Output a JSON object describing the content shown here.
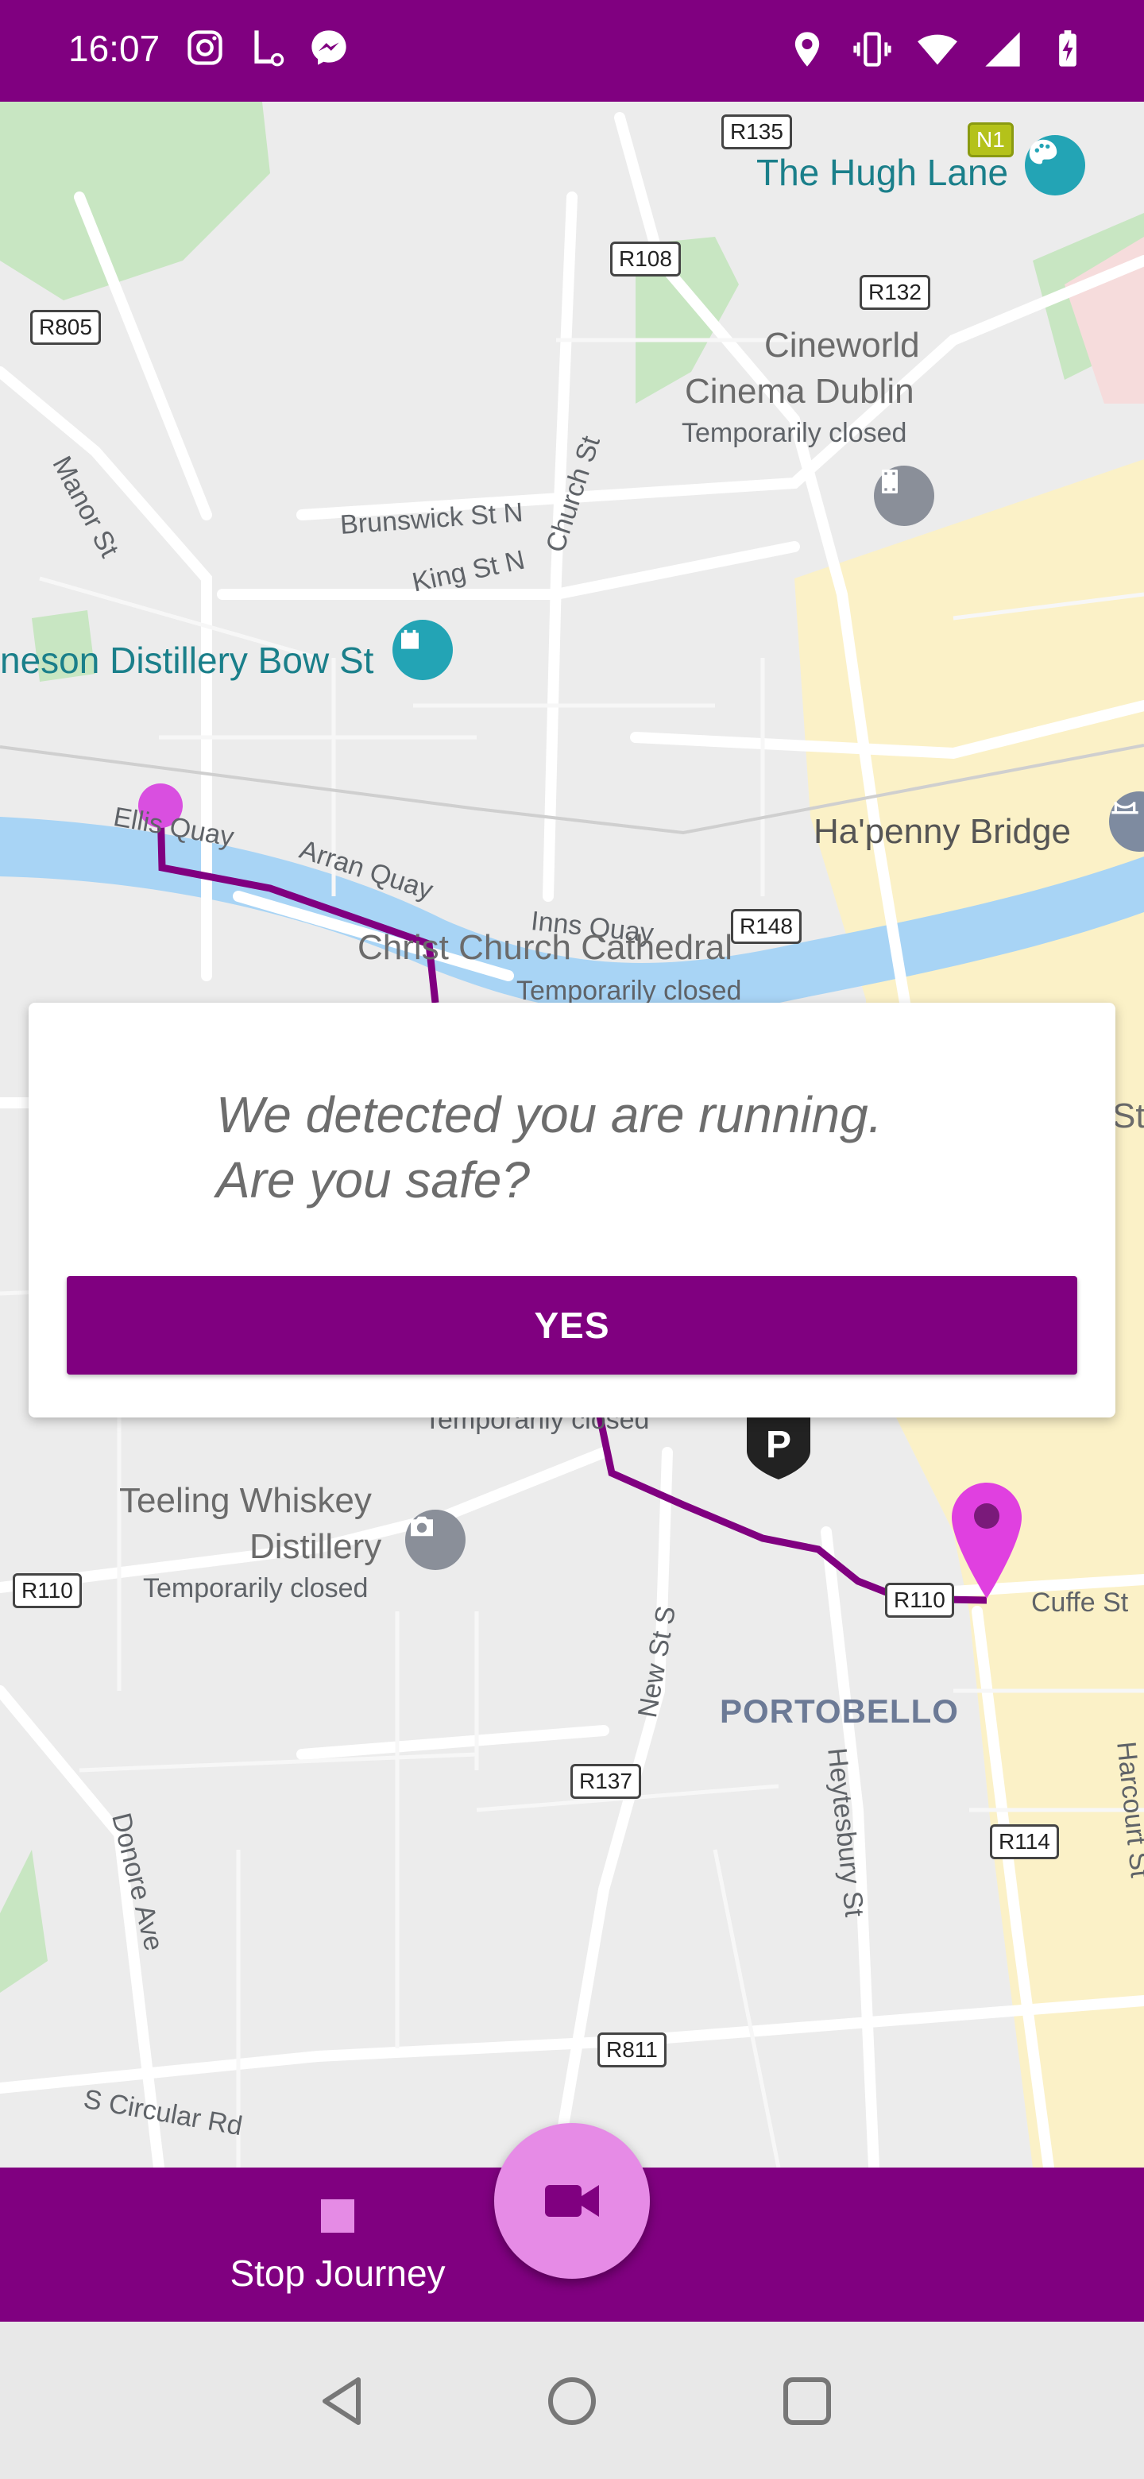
{
  "status_bar": {
    "time": "16:07",
    "left_icons": [
      "instagram-icon",
      "location-badge-icon",
      "messenger-icon"
    ],
    "right_icons": [
      "location-pin-icon",
      "vibrate-icon",
      "wifi-icon",
      "cell-signal-icon",
      "battery-charging-icon"
    ]
  },
  "map": {
    "labels": {
      "hugh_lane": "The Hugh Lane",
      "cineworld_1": "Cineworld",
      "cineworld_2": "Cinema Dublin",
      "cineworld_status": "Temporarily closed",
      "manor_st": "Manor St",
      "brunswick_st": "Brunswick St N",
      "king_st": "King St N",
      "church_st": "Church St",
      "jameson": "neson Distillery Bow St",
      "ellis_quay": "Ellis Quay",
      "arran_quay": "Arran Quay",
      "inns_quay": "Inns Quay",
      "hapenny": "Ha'penny Bridge",
      "christ_church": "Christ Church Cathedral",
      "christ_church_status": "Temporarily closed",
      "temp_closed_lower": "Temporarily closed",
      "teeling_1": "Teeling Whiskey",
      "teeling_2": "Distillery",
      "teeling_status": "Temporarily closed",
      "new_st": "New St S",
      "portobello": "PORTOBELLO",
      "heytesbury": "Heytesbury St",
      "cuffe_st": "Cuffe St",
      "harcourt": "Harcourt St",
      "donore": "Donore Ave",
      "s_circular": "S Circular Rd",
      "st_partial": "St"
    },
    "shields": {
      "r135": "R135",
      "n1": "N1",
      "r108": "R108",
      "r132": "R132",
      "r805": "R805",
      "r148": "R148",
      "r110_left": "R110",
      "r110_right": "R110",
      "r137": "R137",
      "r114": "R114",
      "r811": "R811"
    }
  },
  "dialog": {
    "message_line1": "We detected you are running.",
    "message_line2": "Are you safe?",
    "yes_label": "YES"
  },
  "bottom_bar": {
    "stop_label": "Stop Journey",
    "fab_icon": "video-camera-icon"
  },
  "colors": {
    "primary": "#800080",
    "accent": "#e68be6",
    "route": "#800080",
    "start_marker": "#d94fe0",
    "end_marker": "#e040e0"
  }
}
